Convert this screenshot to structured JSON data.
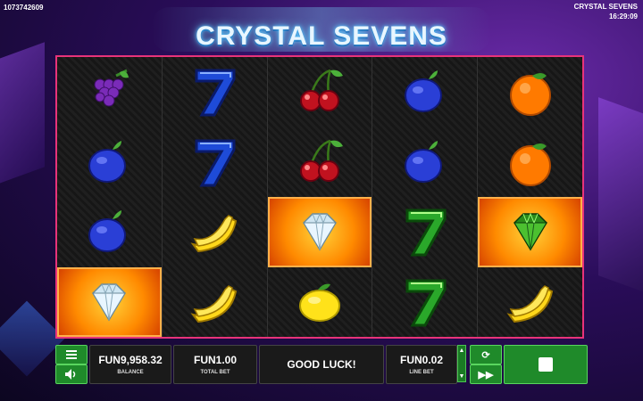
{
  "topbar": {
    "session_id": "1073742609",
    "game_name": "CRYSTAL SEVENS",
    "clock": "16:29:09"
  },
  "logo": {
    "title": "CRYSTAL SEVENS"
  },
  "reels": [
    [
      "grapes",
      "plum",
      "plum",
      "diamond-white"
    ],
    [
      "seven-blue",
      "seven-blue",
      "banana",
      "banana"
    ],
    [
      "cherry",
      "cherry",
      "diamond-white",
      "lemon"
    ],
    [
      "plum",
      "plum",
      "seven-green",
      "seven-green"
    ],
    [
      "orange",
      "orange",
      "diamond-green",
      "banana"
    ]
  ],
  "win_cells": [
    [
      0,
      3
    ],
    [
      2,
      2
    ],
    [
      4,
      2
    ]
  ],
  "controls": {
    "balance_value": "FUN9,958.32",
    "balance_label": "BALANCE",
    "total_bet_value": "FUN1.00",
    "total_bet_label": "TOTAL BET",
    "message": "GOOD LUCK!",
    "line_bet_value": "FUN0.02",
    "line_bet_label": "LINE BET",
    "menu_icon": "menu-icon",
    "sound_icon": "sound-icon",
    "autoplay_icon": "refresh-icon",
    "fast_icon": "fast-forward-icon",
    "spin_icon": "stop-icon"
  },
  "colors": {
    "reel_border": "#e8337a",
    "button_green": "#1f8a2a",
    "win_highlight": "#ff8a00"
  }
}
